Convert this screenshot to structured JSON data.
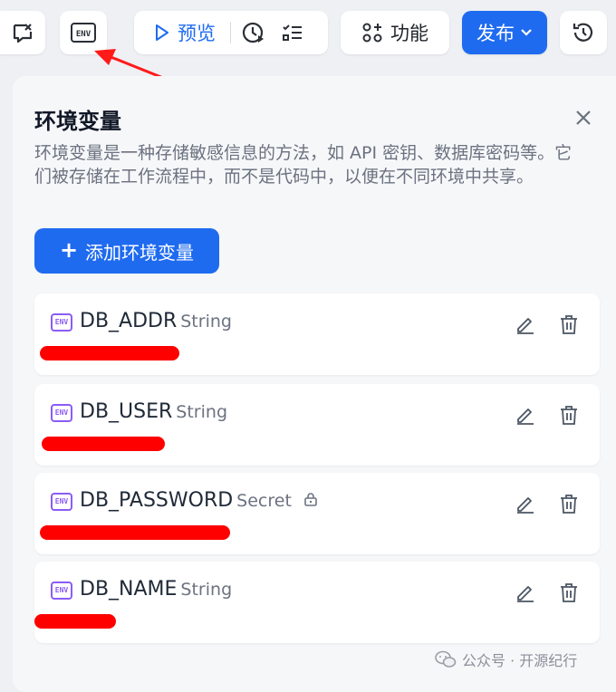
{
  "toolbar": {
    "preview_label": "预览",
    "features_label": "功能",
    "publish_label": "发布"
  },
  "panel": {
    "title": "环境变量",
    "description": "环境变量是一种存储敏感信息的方法，如 API 密钥、数据库密码等。它们被存储在工作流程中，而不是代码中，以便在不同环境中共享。",
    "add_button_label": "添加环境变量",
    "variables": [
      {
        "name": "DB_ADDR",
        "type": "String"
      },
      {
        "name": "DB_USER",
        "type": "String"
      },
      {
        "name": "DB_PASSWORD",
        "type": "Secret"
      },
      {
        "name": "DB_NAME",
        "type": "String"
      }
    ]
  },
  "icons": {
    "env_badge_text": "ENV"
  },
  "watermark": {
    "text": "公众号 · 开源纪行"
  },
  "colors": {
    "accent": "#1f6bf0",
    "env_icon": "#8b5cf6",
    "annotation_red": "#ff0000"
  }
}
